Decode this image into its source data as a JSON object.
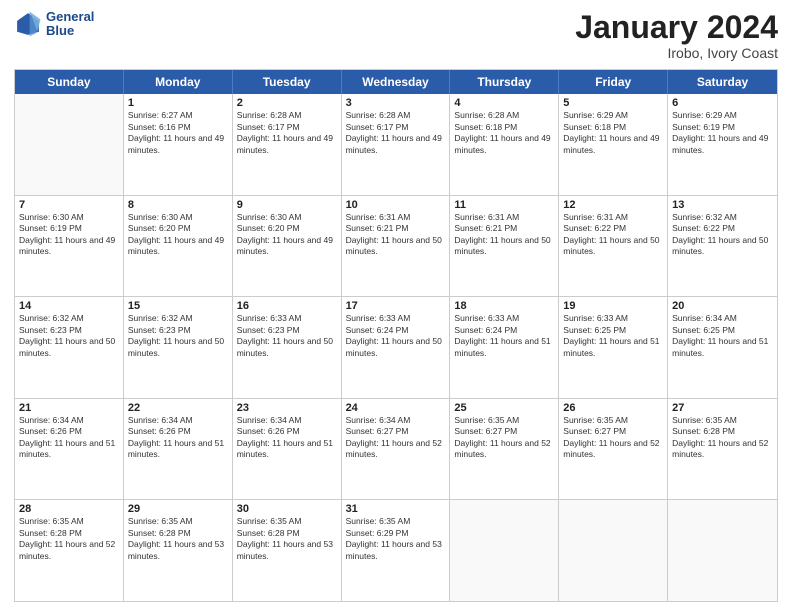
{
  "header": {
    "logo_line1": "General",
    "logo_line2": "Blue",
    "month": "January 2024",
    "location": "Irobo, Ivory Coast"
  },
  "days_of_week": [
    "Sunday",
    "Monday",
    "Tuesday",
    "Wednesday",
    "Thursday",
    "Friday",
    "Saturday"
  ],
  "rows": [
    [
      {
        "day": "",
        "empty": true
      },
      {
        "day": "1",
        "sunrise": "Sunrise: 6:27 AM",
        "sunset": "Sunset: 6:16 PM",
        "daylight": "Daylight: 11 hours and 49 minutes."
      },
      {
        "day": "2",
        "sunrise": "Sunrise: 6:28 AM",
        "sunset": "Sunset: 6:17 PM",
        "daylight": "Daylight: 11 hours and 49 minutes."
      },
      {
        "day": "3",
        "sunrise": "Sunrise: 6:28 AM",
        "sunset": "Sunset: 6:17 PM",
        "daylight": "Daylight: 11 hours and 49 minutes."
      },
      {
        "day": "4",
        "sunrise": "Sunrise: 6:28 AM",
        "sunset": "Sunset: 6:18 PM",
        "daylight": "Daylight: 11 hours and 49 minutes."
      },
      {
        "day": "5",
        "sunrise": "Sunrise: 6:29 AM",
        "sunset": "Sunset: 6:18 PM",
        "daylight": "Daylight: 11 hours and 49 minutes."
      },
      {
        "day": "6",
        "sunrise": "Sunrise: 6:29 AM",
        "sunset": "Sunset: 6:19 PM",
        "daylight": "Daylight: 11 hours and 49 minutes."
      }
    ],
    [
      {
        "day": "7",
        "sunrise": "Sunrise: 6:30 AM",
        "sunset": "Sunset: 6:19 PM",
        "daylight": "Daylight: 11 hours and 49 minutes."
      },
      {
        "day": "8",
        "sunrise": "Sunrise: 6:30 AM",
        "sunset": "Sunset: 6:20 PM",
        "daylight": "Daylight: 11 hours and 49 minutes."
      },
      {
        "day": "9",
        "sunrise": "Sunrise: 6:30 AM",
        "sunset": "Sunset: 6:20 PM",
        "daylight": "Daylight: 11 hours and 49 minutes."
      },
      {
        "day": "10",
        "sunrise": "Sunrise: 6:31 AM",
        "sunset": "Sunset: 6:21 PM",
        "daylight": "Daylight: 11 hours and 50 minutes."
      },
      {
        "day": "11",
        "sunrise": "Sunrise: 6:31 AM",
        "sunset": "Sunset: 6:21 PM",
        "daylight": "Daylight: 11 hours and 50 minutes."
      },
      {
        "day": "12",
        "sunrise": "Sunrise: 6:31 AM",
        "sunset": "Sunset: 6:22 PM",
        "daylight": "Daylight: 11 hours and 50 minutes."
      },
      {
        "day": "13",
        "sunrise": "Sunrise: 6:32 AM",
        "sunset": "Sunset: 6:22 PM",
        "daylight": "Daylight: 11 hours and 50 minutes."
      }
    ],
    [
      {
        "day": "14",
        "sunrise": "Sunrise: 6:32 AM",
        "sunset": "Sunset: 6:23 PM",
        "daylight": "Daylight: 11 hours and 50 minutes."
      },
      {
        "day": "15",
        "sunrise": "Sunrise: 6:32 AM",
        "sunset": "Sunset: 6:23 PM",
        "daylight": "Daylight: 11 hours and 50 minutes."
      },
      {
        "day": "16",
        "sunrise": "Sunrise: 6:33 AM",
        "sunset": "Sunset: 6:23 PM",
        "daylight": "Daylight: 11 hours and 50 minutes."
      },
      {
        "day": "17",
        "sunrise": "Sunrise: 6:33 AM",
        "sunset": "Sunset: 6:24 PM",
        "daylight": "Daylight: 11 hours and 50 minutes."
      },
      {
        "day": "18",
        "sunrise": "Sunrise: 6:33 AM",
        "sunset": "Sunset: 6:24 PM",
        "daylight": "Daylight: 11 hours and 51 minutes."
      },
      {
        "day": "19",
        "sunrise": "Sunrise: 6:33 AM",
        "sunset": "Sunset: 6:25 PM",
        "daylight": "Daylight: 11 hours and 51 minutes."
      },
      {
        "day": "20",
        "sunrise": "Sunrise: 6:34 AM",
        "sunset": "Sunset: 6:25 PM",
        "daylight": "Daylight: 11 hours and 51 minutes."
      }
    ],
    [
      {
        "day": "21",
        "sunrise": "Sunrise: 6:34 AM",
        "sunset": "Sunset: 6:26 PM",
        "daylight": "Daylight: 11 hours and 51 minutes."
      },
      {
        "day": "22",
        "sunrise": "Sunrise: 6:34 AM",
        "sunset": "Sunset: 6:26 PM",
        "daylight": "Daylight: 11 hours and 51 minutes."
      },
      {
        "day": "23",
        "sunrise": "Sunrise: 6:34 AM",
        "sunset": "Sunset: 6:26 PM",
        "daylight": "Daylight: 11 hours and 51 minutes."
      },
      {
        "day": "24",
        "sunrise": "Sunrise: 6:34 AM",
        "sunset": "Sunset: 6:27 PM",
        "daylight": "Daylight: 11 hours and 52 minutes."
      },
      {
        "day": "25",
        "sunrise": "Sunrise: 6:35 AM",
        "sunset": "Sunset: 6:27 PM",
        "daylight": "Daylight: 11 hours and 52 minutes."
      },
      {
        "day": "26",
        "sunrise": "Sunrise: 6:35 AM",
        "sunset": "Sunset: 6:27 PM",
        "daylight": "Daylight: 11 hours and 52 minutes."
      },
      {
        "day": "27",
        "sunrise": "Sunrise: 6:35 AM",
        "sunset": "Sunset: 6:28 PM",
        "daylight": "Daylight: 11 hours and 52 minutes."
      }
    ],
    [
      {
        "day": "28",
        "sunrise": "Sunrise: 6:35 AM",
        "sunset": "Sunset: 6:28 PM",
        "daylight": "Daylight: 11 hours and 52 minutes."
      },
      {
        "day": "29",
        "sunrise": "Sunrise: 6:35 AM",
        "sunset": "Sunset: 6:28 PM",
        "daylight": "Daylight: 11 hours and 53 minutes."
      },
      {
        "day": "30",
        "sunrise": "Sunrise: 6:35 AM",
        "sunset": "Sunset: 6:28 PM",
        "daylight": "Daylight: 11 hours and 53 minutes."
      },
      {
        "day": "31",
        "sunrise": "Sunrise: 6:35 AM",
        "sunset": "Sunset: 6:29 PM",
        "daylight": "Daylight: 11 hours and 53 minutes."
      },
      {
        "day": "",
        "empty": true
      },
      {
        "day": "",
        "empty": true
      },
      {
        "day": "",
        "empty": true
      }
    ]
  ]
}
